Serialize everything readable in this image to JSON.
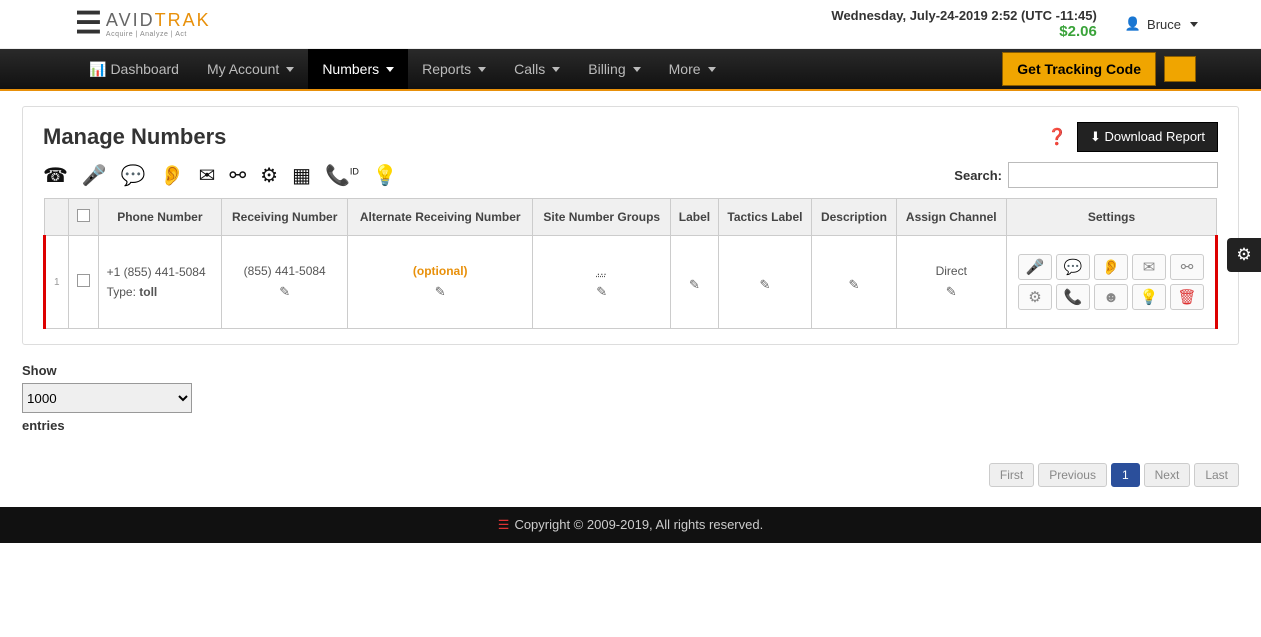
{
  "header": {
    "logo_main": "AVID",
    "logo_sub": "TRAK",
    "logo_tagline": "Acquire | Analyze | Act",
    "datetime": "Wednesday, July-24-2019 2:52 (UTC -11:45)",
    "balance": "$2.06",
    "user": "Bruce"
  },
  "nav": {
    "items": [
      "Dashboard",
      "My Account",
      "Numbers",
      "Reports",
      "Calls",
      "Billing",
      "More"
    ],
    "active_index": 2,
    "get_code": "Get Tracking Code"
  },
  "page": {
    "title": "Manage Numbers",
    "download": "Download Report",
    "search_label": "Search:"
  },
  "columns": [
    "",
    "",
    "Phone Number",
    "Receiving Number",
    "Alternate Receiving Number",
    "Site Number Groups",
    "Label",
    "Tactics Label",
    "Description",
    "Assign Channel",
    "Settings"
  ],
  "row": {
    "index": "1",
    "phone_number": "+1 (855) 441-5084",
    "type_label": "Type: ",
    "type_value": "toll",
    "receiving": "(855) 441-5084",
    "alternate": "(optional)",
    "groups": "...",
    "channel": "Direct"
  },
  "show": {
    "show_label": "Show",
    "value": "1000",
    "entries_label": "entries"
  },
  "pager": {
    "first": "First",
    "prev": "Previous",
    "page": "1",
    "next": "Next",
    "last": "Last"
  },
  "footer": "Copyright © 2009-2019, All rights reserved."
}
